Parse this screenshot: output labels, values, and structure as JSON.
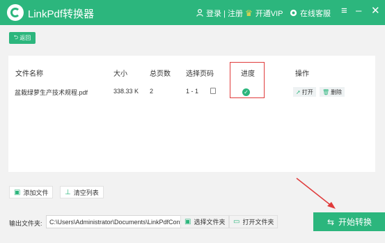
{
  "app": {
    "title": "LinkPdf转换器"
  },
  "titlebar": {
    "login": "登录 | 注册",
    "vip": "开通VIP",
    "service": "在线客服"
  },
  "back": {
    "label": "返回"
  },
  "table": {
    "headers": [
      "文件名称",
      "大小",
      "总页数",
      "选择页码",
      "进度",
      "操作"
    ],
    "row": {
      "name": "盆栽绿萝生产技术规程.pdf",
      "size": "338.33 K",
      "pages": "2",
      "page_range": "1 - 1",
      "progress_status": "complete"
    },
    "actions": {
      "open": "打开",
      "delete": "删除"
    }
  },
  "buttons": {
    "add_file": "添加文件",
    "clear_list": "清空列表"
  },
  "output": {
    "label": "输出文件夹:",
    "path": "C:\\Users\\Administrator\\Documents\\LinkPdfConverter",
    "choose_folder": "选择文件夹",
    "open_folder": "打开文件夹"
  },
  "start": {
    "label": "开始转换"
  },
  "colors": {
    "brand": "#2cb67d",
    "highlight": "#e03b3b"
  }
}
